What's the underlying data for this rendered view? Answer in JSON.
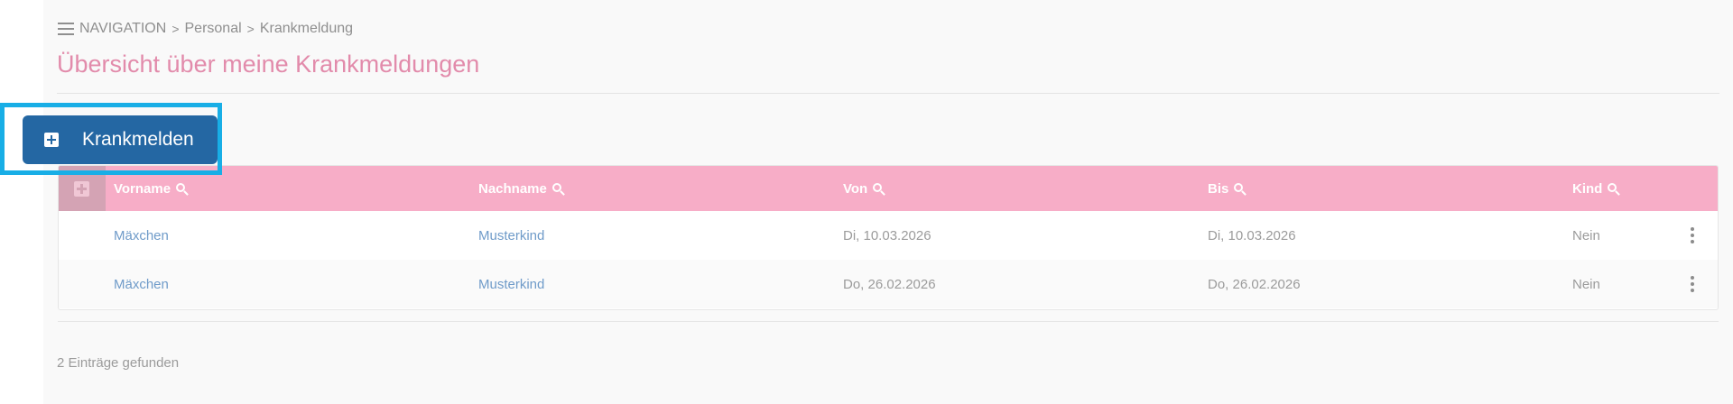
{
  "breadcrumb": {
    "nav_label": "NAVIGATION",
    "level1": "Personal",
    "level2": "Krankmeldung"
  },
  "page": {
    "title": "Übersicht über meine Krankmeldungen"
  },
  "toolbar": {
    "add_label": "Krankmelden"
  },
  "grid": {
    "columns": [
      {
        "label": "Vorname"
      },
      {
        "label": "Nachname"
      },
      {
        "label": "Von"
      },
      {
        "label": "Bis"
      },
      {
        "label": "Kind"
      }
    ],
    "rows": [
      {
        "vorname": "Mäxchen",
        "nachname": "Musterkind",
        "von": "Di, 10.03.2026",
        "bis": "Di, 10.03.2026",
        "kind": "Nein"
      },
      {
        "vorname": "Mäxchen",
        "nachname": "Musterkind",
        "von": "Do, 26.02.2026",
        "bis": "Do, 26.02.2026",
        "kind": "Nein"
      }
    ]
  },
  "footer": {
    "count_text": "2 Einträge gefunden"
  },
  "colors": {
    "title": "#e28bab",
    "header_bg": "#f7adc7",
    "button_bg": "#2467a3",
    "highlight": "#18aee6",
    "link": "#6f9bc9"
  },
  "icons": {
    "menu": "hamburger-menu-icon",
    "add": "plus-square-icon",
    "expand": "plus-square-icon",
    "search": "search-icon",
    "row_menu": "kebab-menu-icon"
  }
}
